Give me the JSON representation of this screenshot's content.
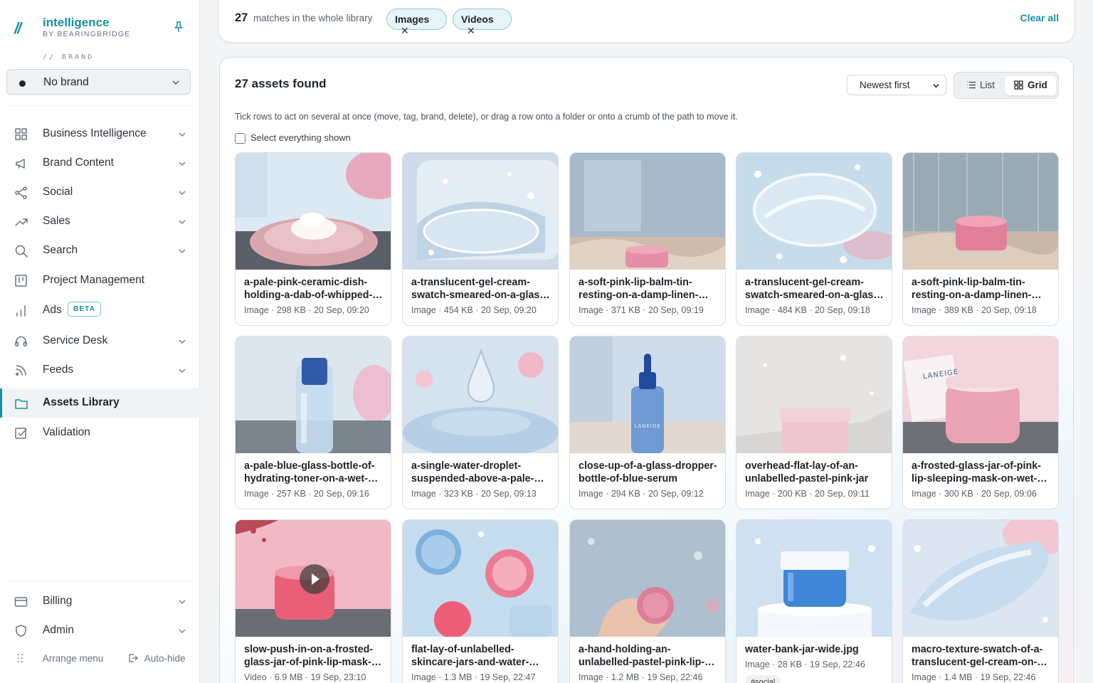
{
  "app": {
    "logo_mark": "//",
    "name": "intelligence",
    "subtitle": "BY BEARINGBRIDGE"
  },
  "brand": {
    "caption": "// BRAND",
    "selected": "No brand"
  },
  "nav": [
    {
      "label": "Business Intelligence",
      "icon": "grid-icon",
      "chevron": true
    },
    {
      "label": "Brand Content",
      "icon": "megaphone-icon",
      "chevron": true
    },
    {
      "label": "Social",
      "icon": "share-icon",
      "chevron": true
    },
    {
      "label": "Sales",
      "icon": "trend-up-icon",
      "chevron": true
    },
    {
      "label": "Search",
      "icon": "search-icon",
      "chevron": true
    },
    {
      "label": "Project Management",
      "icon": "kanban-icon",
      "chevron": false
    },
    {
      "label": "Ads",
      "icon": "bar-chart-icon",
      "chevron": false,
      "badge": "BETA"
    },
    {
      "label": "Service Desk",
      "icon": "headset-icon",
      "chevron": true
    },
    {
      "label": "Feeds",
      "icon": "rss-icon",
      "chevron": true
    },
    {
      "label": "Assets Library",
      "icon": "folder-icon",
      "chevron": false,
      "active": true
    },
    {
      "label": "Validation",
      "icon": "check-square-icon",
      "chevron": false
    }
  ],
  "nav_bottom": [
    {
      "label": "Billing",
      "icon": "credit-card-icon",
      "chevron": true
    },
    {
      "label": "Admin",
      "icon": "shield-icon",
      "chevron": true
    }
  ],
  "footer": {
    "arrange": "Arrange menu",
    "autohide": "Auto-hide"
  },
  "filters": {
    "count": "27",
    "text": "matches in the whole library",
    "chips": [
      "Images",
      "Videos"
    ],
    "clear_all": "Clear all"
  },
  "results": {
    "title": "27 assets found",
    "sort": "Newest first",
    "view_list": "List",
    "view_grid": "Grid",
    "hint": "Tick rows to act on several at once (move, tag, brand, delete), or drag a row onto a folder or onto a crumb of the path to move it.",
    "select_all": "Select everything shown"
  },
  "assets": [
    {
      "title": "a-pale-pink-ceramic-dish-holding-a-dab-of-whipped-cream-on-a-wet-stone",
      "meta": "Image · 298 KB · 20 Sep, 09:20",
      "thumb": "cream-dish"
    },
    {
      "title": "a-translucent-gel-cream-swatch-smeared-on-a-glass-plate",
      "meta": "Image · 454 KB · 20 Sep, 09:20",
      "thumb": "gel-swatch"
    },
    {
      "title": "a-soft-pink-lip-balm-tin-resting-on-a-damp-linen-cloth",
      "meta": "Image · 371 KB · 20 Sep, 09:19",
      "thumb": "balm-window"
    },
    {
      "title": "a-translucent-gel-cream-swatch-smeared-on-a-glass-surface",
      "meta": "Image · 484 KB · 20 Sep, 09:18",
      "thumb": "gel-swatch-2"
    },
    {
      "title": "a-soft-pink-lip-balm-tin-resting-on-a-damp-linen-windowsill",
      "meta": "Image · 389 KB · 20 Sep, 09:18",
      "thumb": "balm-rain"
    },
    {
      "title": "a-pale-blue-glass-bottle-of-hydrating-toner-on-a-wet-surface",
      "meta": "Image · 257 KB · 20 Sep, 09:16",
      "thumb": "toner-bottle"
    },
    {
      "title": "a-single-water-droplet-suspended-above-a-pale-blue-cream",
      "meta": "Image · 323 KB · 20 Sep, 09:13",
      "thumb": "droplet"
    },
    {
      "title": "close-up-of-a-glass-dropper-bottle-of-blue-serum",
      "meta": "Image · 294 KB · 20 Sep, 09:12",
      "thumb": "dropper",
      "label": "LANEIGE"
    },
    {
      "title": "overhead-flat-lay-of-an-unlabelled-pastel-pink-jar",
      "meta": "Image · 200 KB · 20 Sep, 09:11",
      "thumb": "pink-jar-stone"
    },
    {
      "title": "a-frosted-glass-jar-of-pink-lip-sleeping-mask-on-wet-stone",
      "meta": "Image · 300 KB · 20 Sep, 09:06",
      "thumb": "laneige-jar",
      "label": "LANEIGE"
    },
    {
      "title": "slow-push-in-on-a-frosted-glass-jar-of-pink-lip-mask-video",
      "meta": "Video · 6.9 MB · 19 Sep, 23:10",
      "thumb": "video-jar",
      "video": true
    },
    {
      "title": "flat-lay-of-unlabelled-skincare-jars-and-water-drops",
      "meta": "Image · 1.3 MB · 19 Sep, 22:47",
      "thumb": "flatlay"
    },
    {
      "title": "a-hand-holding-an-unlabelled-pastel-pink-lip-balm",
      "meta": "Image · 1.2 MB · 19 Sep, 22:46",
      "thumb": "hand-balm"
    },
    {
      "title": "water-bank-jar-wide.jpg",
      "meta": "Image · 28 KB · 19 Sep, 22:46",
      "thumb": "blue-jar",
      "short": true,
      "tag": "#social"
    },
    {
      "title": "macro-texture-swatch-of-a-translucent-gel-cream-on-glass",
      "meta": "Image · 1.4 MB · 19 Sep, 22:46",
      "thumb": "macro-gel"
    }
  ],
  "colors": {
    "accent": "#1a8fa3",
    "chip_bg": "#e6f4f7",
    "chip_border": "#8ccad6"
  }
}
